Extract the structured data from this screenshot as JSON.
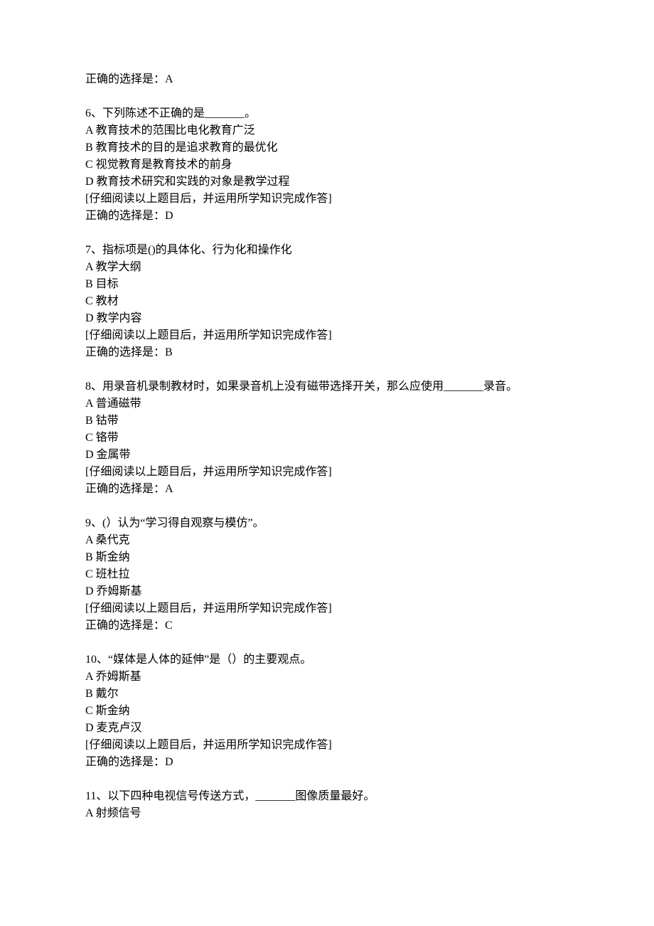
{
  "intro_answer": "正确的选择是：A",
  "questions": [
    {
      "number": "6",
      "stem": "下列陈述不正确的是_______。",
      "options": [
        "A 教育技术的范围比电化教育广泛",
        "B 教育技术的目的是追求教育的最优化",
        "C 视觉教育是教育技术的前身",
        "D 教育技术研究和实践的对象是教学过程"
      ],
      "instruction": "[仔细阅读以上题目后，并运用所学知识完成作答]",
      "answer": "正确的选择是：D"
    },
    {
      "number": "7",
      "stem": "指标项是()的具体化、行为化和操作化",
      "options": [
        "A 教学大纲",
        "B 目标",
        "C 教材",
        "D 教学内容"
      ],
      "instruction": "[仔细阅读以上题目后，并运用所学知识完成作答]",
      "answer": "正确的选择是：B"
    },
    {
      "number": "8",
      "stem": "用录音机录制教材时，如果录音机上没有磁带选择开关，那么应使用_______录音。",
      "options": [
        "A 普通磁带",
        "B 钴带",
        "C 铬带",
        "D 金属带"
      ],
      "instruction": "[仔细阅读以上题目后，并运用所学知识完成作答]",
      "answer": "正确的选择是：A"
    },
    {
      "number": "9",
      "stem": "(）认为“学习得自观察与模仿”。",
      "options": [
        "A 桑代克",
        "B 斯金纳",
        "C 班杜拉",
        "D 乔姆斯基"
      ],
      "instruction": "[仔细阅读以上题目后，并运用所学知识完成作答]",
      "answer": "正确的选择是：C"
    },
    {
      "number": "10",
      "stem": "“媒体是人体的延伸”是（）的主要观点。",
      "options": [
        "A 乔姆斯基",
        "B 戴尔",
        "C 斯金纳",
        "D 麦克卢汉"
      ],
      "instruction": "[仔细阅读以上题目后，并运用所学知识完成作答]",
      "answer": "正确的选择是：D"
    },
    {
      "number": "11",
      "stem": "以下四种电视信号传送方式，_______图像质量最好。",
      "options": [
        "A 射频信号"
      ],
      "instruction": "",
      "answer": ""
    }
  ]
}
